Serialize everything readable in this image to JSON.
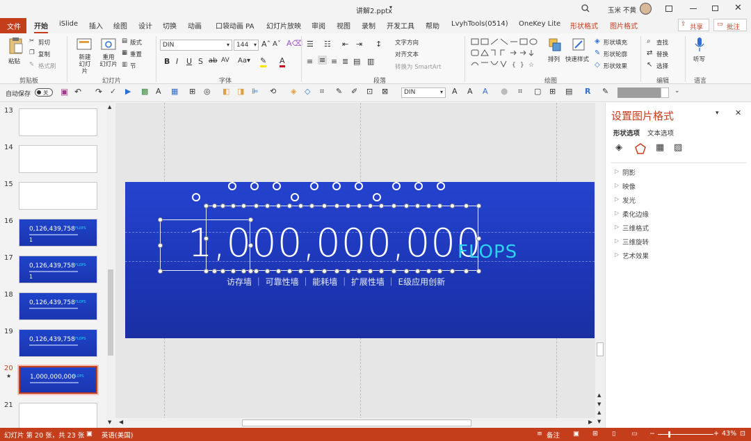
{
  "window": {
    "title": "讲解2.pptx",
    "user": "玉米 不黄",
    "controls": [
      "minimize",
      "restore",
      "close"
    ]
  },
  "tabs": {
    "file": "文件",
    "items": [
      "开始",
      "iSlide",
      "插入",
      "绘图",
      "设计",
      "切换",
      "动画",
      "口袋动画 PA",
      "幻灯片放映",
      "审阅",
      "视图",
      "录制",
      "开发工具",
      "帮助",
      "LvyhTools(0514)",
      "OneKey Lite",
      "形状格式",
      "图片格式"
    ],
    "active": "开始",
    "share": "共享",
    "comment": "批注"
  },
  "ribbon": {
    "clipboard": {
      "paste": "粘贴",
      "cut": "剪切",
      "copy": "复制",
      "format_painter": "格式刷",
      "label": "剪贴板"
    },
    "slides": {
      "new_slide": "新建\n幻灯片",
      "reuse": "重用\n幻灯片",
      "layout": "版式",
      "reset": "重置",
      "section": "节",
      "label": "幻灯片"
    },
    "font": {
      "name": "DIN",
      "size": "144",
      "label": "字体"
    },
    "paragraph": {
      "text_direction": "文字方向",
      "align_text": "对齐文本",
      "smartart": "转换为 SmartArt",
      "label": "段落"
    },
    "drawing": {
      "arrange": "排列",
      "quick_styles": "快速样式",
      "fill": "形状填充",
      "outline": "形状轮廓",
      "effects": "形状效果",
      "label": "绘图"
    },
    "editing": {
      "find": "查找",
      "replace": "替换",
      "select": "选择",
      "label": "编辑"
    },
    "voice": {
      "dictate": "听写",
      "label": "语言"
    }
  },
  "qat": {
    "autosave": "自动保存",
    "toggle": "关",
    "font": "DIN"
  },
  "thumbnails": [
    {
      "num": "13",
      "type": "blank"
    },
    {
      "num": "14",
      "type": "blank"
    },
    {
      "num": "15",
      "type": "blank"
    },
    {
      "num": "16",
      "type": "blue",
      "text": "0,126,439,758",
      "extra": "1"
    },
    {
      "num": "17",
      "type": "blue",
      "text": "0,126,439,758",
      "extra": "1"
    },
    {
      "num": "18",
      "type": "blue",
      "text": "0,126,439,758"
    },
    {
      "num": "19",
      "type": "blue",
      "text": "0,126,439,758"
    },
    {
      "num": "20",
      "type": "blue",
      "text": "1,000,000,000",
      "selected": true
    },
    {
      "num": "21",
      "type": "blank"
    }
  ],
  "thumb_unit": "FLOPS",
  "slide": {
    "number": "1,000,000,000",
    "unit": "FLOPS",
    "subtitle": "访存墙  ｜  可靠性墙  ｜  能耗墙  ｜  扩展性墙  ｜  E级应用创新"
  },
  "format_pane": {
    "title": "设置图片格式",
    "tab_shape": "形状选项",
    "tab_text": "文本选项",
    "items": [
      "阴影",
      "映像",
      "发光",
      "柔化边缘",
      "三维格式",
      "三维旋转",
      "艺术效果"
    ]
  },
  "status": {
    "slide_info": "幻灯片 第 20 张，共 23 张",
    "language": "英语(美国)",
    "notes": "备注",
    "zoom": "43%"
  },
  "colors": {
    "accent": "#c43e1c",
    "slide_bg": "#1f3fc7",
    "flops": "#2bd3f0"
  }
}
